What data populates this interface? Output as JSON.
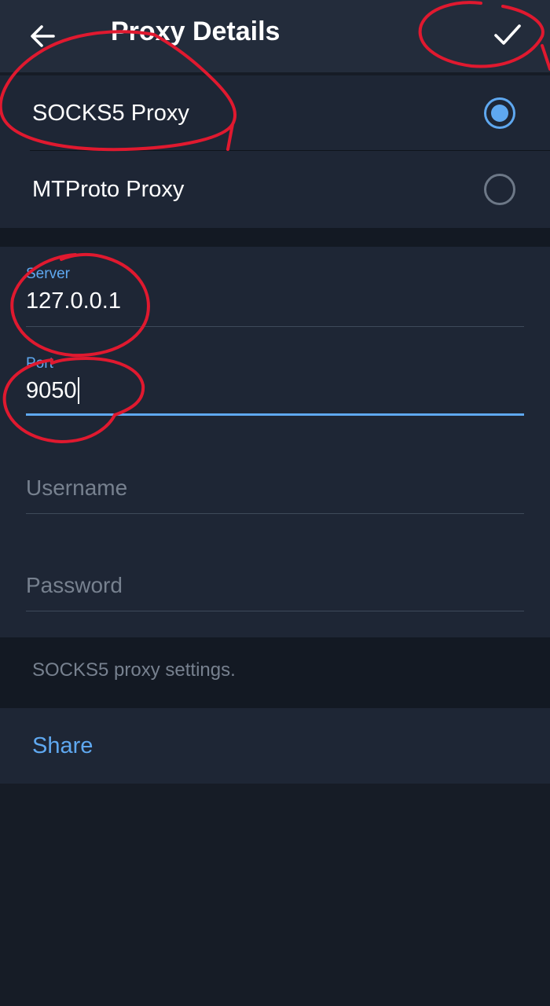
{
  "appbar": {
    "title": "Proxy Details",
    "back_icon": "arrow-left-icon",
    "confirm_icon": "checkmark-icon"
  },
  "proxy_types": [
    {
      "label": "SOCKS5 Proxy",
      "selected": true
    },
    {
      "label": "MTProto Proxy",
      "selected": false
    }
  ],
  "form": {
    "server": {
      "label": "Server",
      "value": "127.0.0.1"
    },
    "port": {
      "label": "Port",
      "value": "9050",
      "focused": true
    },
    "username": {
      "placeholder": "Username",
      "value": ""
    },
    "password": {
      "placeholder": "Password",
      "value": ""
    }
  },
  "info": {
    "text": "SOCKS5 proxy settings."
  },
  "share": {
    "label": "Share"
  },
  "colors": {
    "accent": "#5fa8f0",
    "background": "#161c26",
    "surface": "#1e2635",
    "appbar": "#232c3b",
    "annotation": "#e0192f"
  }
}
